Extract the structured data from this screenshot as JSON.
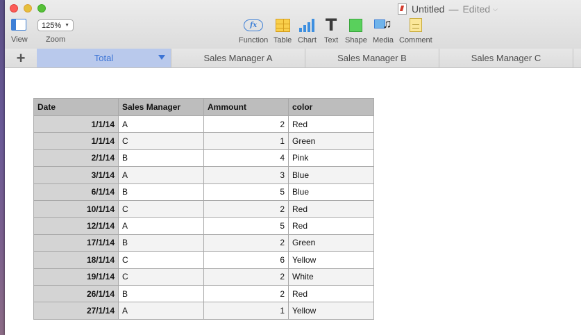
{
  "window": {
    "title": "Untitled",
    "separator": "—",
    "status": "Edited"
  },
  "toolbar": {
    "view_label": "View",
    "zoom_value": "125%",
    "zoom_label": "Zoom",
    "function_label": "Function",
    "function_icon_text": "fx",
    "table_label": "Table",
    "chart_label": "Chart",
    "text_label": "Text",
    "text_icon_glyph": "T",
    "shape_label": "Shape",
    "media_label": "Media",
    "comment_label": "Comment"
  },
  "sheets": {
    "add_label": "+",
    "tabs": [
      {
        "label": "Total",
        "active": true
      },
      {
        "label": "Sales Manager A"
      },
      {
        "label": "Sales Manager B"
      },
      {
        "label": "Sales Manager C"
      }
    ]
  },
  "table": {
    "headers": [
      "Date",
      "Sales Manager",
      "Ammount",
      "color"
    ],
    "rows": [
      [
        "1/1/14",
        "A",
        "2",
        "Red"
      ],
      [
        "1/1/14",
        "C",
        "1",
        "Green"
      ],
      [
        "2/1/14",
        "B",
        "4",
        "Pink"
      ],
      [
        "3/1/14",
        "A",
        "3",
        "Blue"
      ],
      [
        "6/1/14",
        "B",
        "5",
        "Blue"
      ],
      [
        "10/1/14",
        "C",
        "2",
        "Red"
      ],
      [
        "12/1/14",
        "A",
        "5",
        "Red"
      ],
      [
        "17/1/14",
        "B",
        "2",
        "Green"
      ],
      [
        "18/1/14",
        "C",
        "6",
        "Yellow"
      ],
      [
        "19/1/14",
        "C",
        "2",
        "White"
      ],
      [
        "26/1/14",
        "B",
        "2",
        "Red"
      ],
      [
        "27/1/14",
        "A",
        "1",
        "Yellow"
      ]
    ]
  },
  "colors": {
    "accent": "#3b73d5",
    "active_tab_bg": "#b9c9ec"
  }
}
